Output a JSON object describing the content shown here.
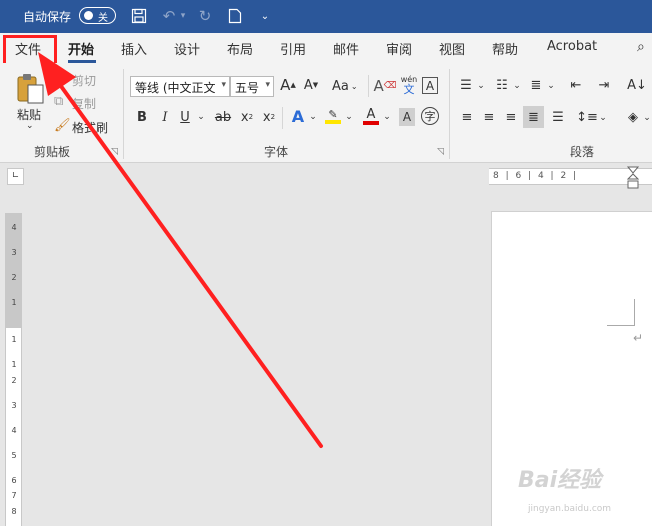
{
  "titlebar": {
    "autosave_label": "自动保存",
    "autosave_state": "关",
    "save_icon": "save-icon",
    "undo_icon": "undo-icon",
    "redo_icon": "redo-icon",
    "new_doc_icon": "new-document-icon",
    "customize_icon": "customize-quick-access-icon"
  },
  "tabs": [
    {
      "label": "文件"
    },
    {
      "label": "开始"
    },
    {
      "label": "插入"
    },
    {
      "label": "设计"
    },
    {
      "label": "布局"
    },
    {
      "label": "引用"
    },
    {
      "label": "邮件"
    },
    {
      "label": "审阅"
    },
    {
      "label": "视图"
    },
    {
      "label": "帮助"
    },
    {
      "label": "Acrobat"
    }
  ],
  "active_tab": "开始",
  "clipboard": {
    "paste_label": "粘贴",
    "cut_label": "剪切",
    "copy_label": "复制",
    "format_painter_label": "格式刷",
    "group_label": "剪贴板"
  },
  "font": {
    "font_name": "等线 (中文正文",
    "font_size": "五号",
    "group_label": "字体",
    "pinyin_top": "wén",
    "pinyin_bottom": "文",
    "grow_label": "A",
    "shrink_label": "A",
    "case_label": "Aa",
    "bold": "B",
    "italic": "I",
    "underline": "U",
    "strike": "ab",
    "subscript": "x",
    "superscript": "x",
    "effects": "A",
    "highlight": "ab",
    "font_color": "A",
    "char_shading": "A",
    "enclosed": "字"
  },
  "paragraph": {
    "group_label": "段落"
  },
  "ruler": {
    "horizontal_text": "8 | 6 | 4 | 2 |",
    "vertical_numbers": [
      "4",
      "3",
      "2",
      "1",
      "1",
      "1",
      "2",
      "3",
      "4",
      "5",
      "6",
      "7",
      "8"
    ]
  },
  "colors": {
    "titlebar": "#2b579a",
    "highlight_frame": "#ff2020",
    "arrow": "#ff2020",
    "highlight_yellow": "#ffe600",
    "font_red": "#e00000"
  },
  "watermark": {
    "brand": "Bai经验",
    "url": "jingyan.baidu.com"
  }
}
